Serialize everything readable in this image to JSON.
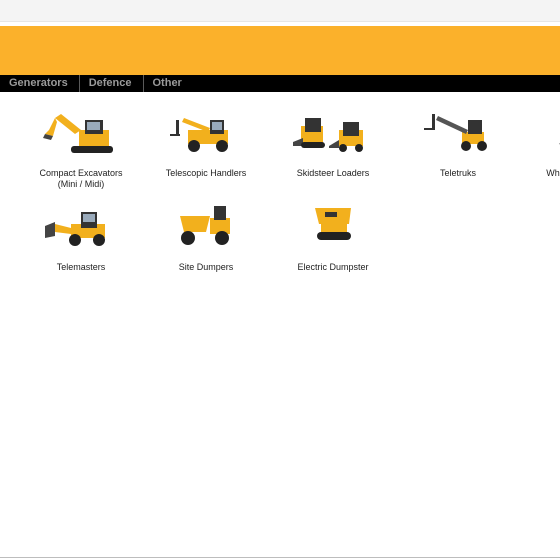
{
  "nav": {
    "items": [
      {
        "label": "Generators"
      },
      {
        "label": "Defence"
      },
      {
        "label": "Other"
      }
    ]
  },
  "colors": {
    "banner": "#fbb12b",
    "navbar": "#000000",
    "nav_text": "#9a9a9a",
    "machine_yellow": "#f2b01d"
  },
  "catalog": {
    "row1": [
      {
        "label": "Compact Excavators\n(Mini / Midi)",
        "icon": "excavator-icon"
      },
      {
        "label": "Telescopic Handlers",
        "icon": "telescopic-handler-icon"
      },
      {
        "label": "Skidsteer Loaders",
        "icon": "skidsteer-icon"
      },
      {
        "label": "Teletruks",
        "icon": "teletruk-icon"
      },
      {
        "label": "Wheel",
        "icon": "wheel-loader-icon"
      }
    ],
    "row2": [
      {
        "label": "Telemasters",
        "icon": "telemaster-icon"
      },
      {
        "label": "Site Dumpers",
        "icon": "site-dumper-icon"
      },
      {
        "label": "Electric Dumpster",
        "icon": "electric-dumpster-icon"
      }
    ]
  }
}
